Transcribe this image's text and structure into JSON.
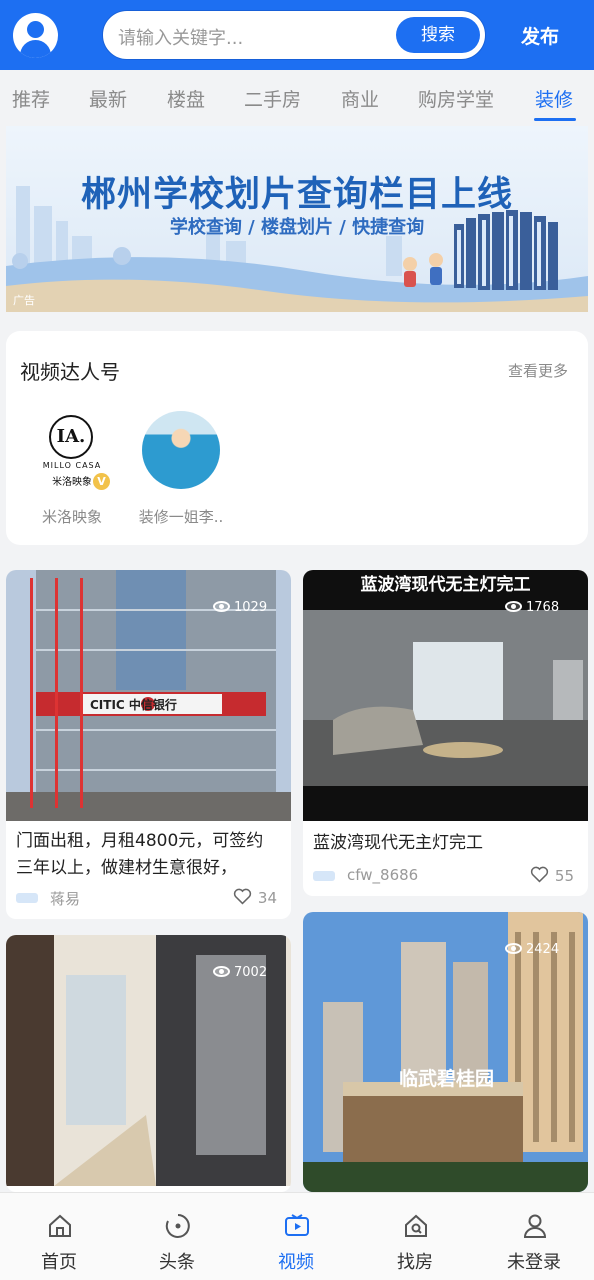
{
  "header": {
    "search_placeholder": "请输入关键字...",
    "search_button": "搜索",
    "publish": "发布"
  },
  "tabs": [
    {
      "label": "推荐"
    },
    {
      "label": "最新"
    },
    {
      "label": "楼盘"
    },
    {
      "label": "二手房"
    },
    {
      "label": "商业"
    },
    {
      "label": "购房学堂"
    },
    {
      "label": "装修"
    }
  ],
  "active_tab": "装修",
  "banner": {
    "title": "郴州学校划片查询栏目上线",
    "subtitle": "学校查询 / 楼盘划片 / 快捷查询",
    "ad_label": "广告"
  },
  "creators": {
    "title": "视频达人号",
    "more": "查看更多",
    "items": [
      {
        "name": "米洛映象",
        "logo_text": "MILLO CASA",
        "logo_cn": "米洛映象",
        "logo_mark": "IA.",
        "verified": "V"
      },
      {
        "name": "装修一姐李.."
      }
    ]
  },
  "feed": [
    {
      "title": "门面出租，月租4800元，可签约三年以上，做建材生意很好，",
      "author": "蒋易",
      "likes": "34",
      "views": "1029",
      "sign_text": "CITIC 中信银行"
    },
    {
      "title": "蓝波湾现代无主灯完工",
      "author": "cfw_8686",
      "likes": "55",
      "views": "1768",
      "caption": "蓝波湾现代无主灯完工"
    },
    {
      "views": "7002"
    },
    {
      "views": "2424",
      "sign_text": "临武碧桂园"
    }
  ],
  "bottom_nav": [
    {
      "label": "首页",
      "icon": "home-icon"
    },
    {
      "label": "头条",
      "icon": "headline-icon"
    },
    {
      "label": "视频",
      "icon": "video-icon"
    },
    {
      "label": "找房",
      "icon": "find-house-icon"
    },
    {
      "label": "未登录",
      "icon": "user-icon"
    }
  ],
  "active_nav": "视频",
  "colors": {
    "accent": "#1d6ff2",
    "background": "#f2f3f5"
  }
}
